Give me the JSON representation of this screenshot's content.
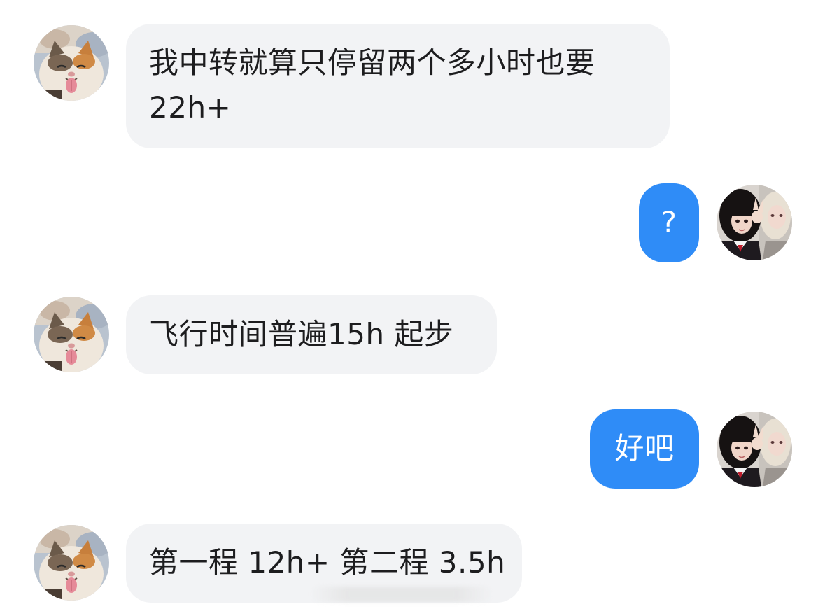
{
  "chat": {
    "messages": [
      {
        "sender": "other",
        "lines": [
          "我中转就算只停留两个多小时也要",
          "22h+"
        ]
      },
      {
        "sender": "me",
        "text": "?"
      },
      {
        "sender": "other",
        "text": "飞行时间普遍15h 起步"
      },
      {
        "sender": "me",
        "text": "好吧"
      },
      {
        "sender": "other",
        "text": "第一程 12h+ 第二程 3.5h"
      }
    ]
  },
  "colors": {
    "incoming_bubble": "#f2f3f5",
    "outgoing_bubble": "#2f8cf7",
    "incoming_text": "#1d1d1f",
    "outgoing_text": "#ffffff"
  },
  "avatars": {
    "other": "cat-avatar",
    "me": "girls-photo-avatar"
  }
}
